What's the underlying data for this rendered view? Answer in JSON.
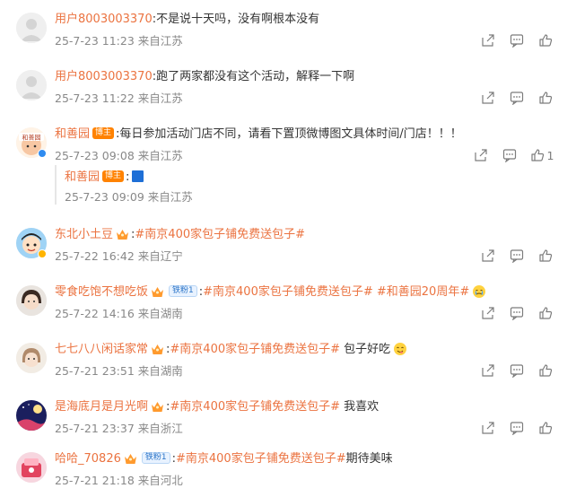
{
  "comments": [
    {
      "user": "用户8003003370",
      "text": ":不是说十天吗，没有啊根本没有",
      "meta": "25-7-23 11:23 来自江苏"
    },
    {
      "user": "用户8003003370",
      "text": ":跑了两家都没有这个活动，解释一下啊",
      "meta": "25-7-23 11:22 来自江苏"
    },
    {
      "user": "和善园",
      "badge": "博主",
      "text": ":每日参加活动门店不同，请看下置顶微博图文具体时间/门店！！！",
      "meta": "25-7-23 09:08 来自江苏",
      "likes": "1",
      "avatar_text": "和善园"
    },
    {
      "user": "东北小土豆",
      "tag": "#南京400家包子铺免费送包子#",
      "meta": "25-7-22 16:42 来自辽宁"
    },
    {
      "user": "零食吃饱不想吃饭",
      "fanbadge": "铁粉1",
      "tag": "#南京400家包子铺免费送包子#",
      "tag2": "#和善园20周年#",
      "meta": "25-7-22 14:16 来自湖南"
    },
    {
      "user": "七七八八闲话家常",
      "tag": "#南京400家包子铺免费送包子#",
      "text": " 包子好吃",
      "meta": "25-7-21 23:51 来自湖南"
    },
    {
      "user": "是海底月是月光啊",
      "tag": "#南京400家包子铺免费送包子#",
      "text": " 我喜欢",
      "meta": "25-7-21 23:37 来自浙江"
    },
    {
      "user": "哈哈_70826",
      "fanbadge": "铁粉1",
      "tag": "#南京400家包子铺免费送包子#",
      "text": "期待美味",
      "meta": "25-7-21 21:18 来自河北"
    }
  ],
  "reply": {
    "user": "和善园",
    "badge": "博主",
    "text": ":",
    "meta": "25-7-23 09:09 来自江苏"
  },
  "colors": {
    "username": "#eb7340",
    "meta": "#888888",
    "icon": "#7c7c7c"
  },
  "icons": [
    "share-icon",
    "comment-icon",
    "like-icon"
  ]
}
